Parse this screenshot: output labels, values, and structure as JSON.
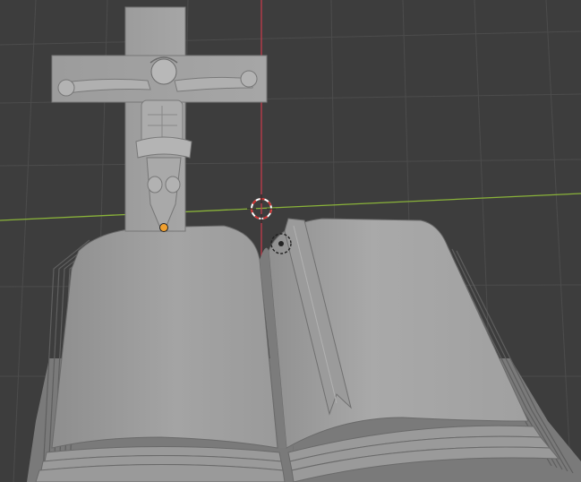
{
  "viewport": {
    "editor": "3D Viewport",
    "view": "perspective",
    "colors": {
      "background": "#3d3d3d",
      "grid_line": "#4d4d4d",
      "x_axis": "#8ab33a",
      "y_axis": "#c23b4a",
      "mesh_light": "#a8a8a8",
      "mesh_mid": "#8f8f8f",
      "mesh_dark": "#6e6e6e",
      "origin_dot": "#f0a030"
    },
    "icons": {
      "cursor": "3d-cursor-icon",
      "origin": "object-origin-icon",
      "light": "light-gizmo-icon"
    }
  },
  "scene": {
    "objects": [
      {
        "name": "crucifix",
        "type": "mesh",
        "selected": false
      },
      {
        "name": "open-book",
        "type": "mesh",
        "selected": false
      },
      {
        "name": "ribbon-bookmark",
        "type": "mesh",
        "selected": false
      }
    ]
  }
}
